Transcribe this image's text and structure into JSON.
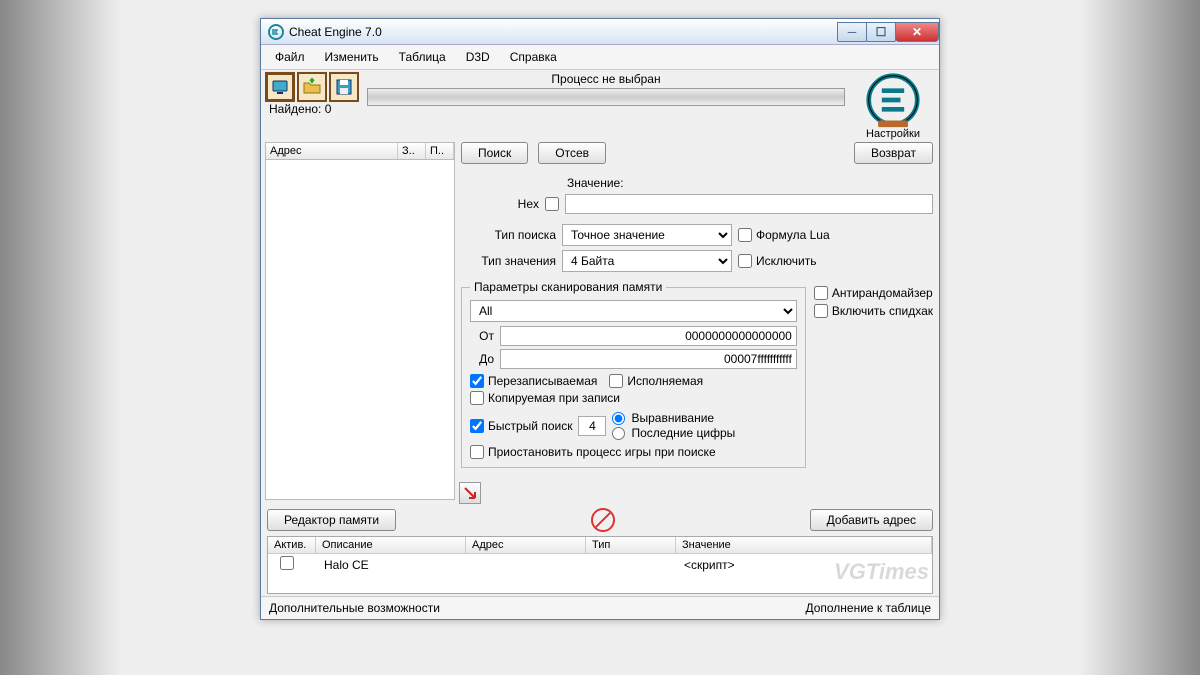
{
  "window": {
    "title": "Cheat Engine 7.0"
  },
  "menu": {
    "file": "Файл",
    "edit": "Изменить",
    "table": "Таблица",
    "d3d": "D3D",
    "help": "Справка"
  },
  "toolbar": {
    "process_status": "Процесс не выбран",
    "found_label": "Найдено:",
    "found_count": "0"
  },
  "logo": {
    "settings": "Настройки"
  },
  "results": {
    "col_address": "Адрес",
    "col_s": "З..",
    "col_p": "П.."
  },
  "buttons": {
    "search": "Поиск",
    "filter": "Отсев",
    "undo": "Возврат",
    "mem_editor": "Редактор памяти",
    "add_addr": "Добавить адрес"
  },
  "labels": {
    "value": "Значение:",
    "hex": "Hex",
    "search_type": "Тип поиска",
    "value_type": "Тип значения",
    "lua": "Формула Lua",
    "exclude": "Исключить",
    "scan_params": "Параметры сканирования памяти",
    "from": "От",
    "to": "До",
    "writable": "Перезаписываемая",
    "executable": "Исполняемая",
    "cow": "Копируемая при записи",
    "fast": "Быстрый поиск",
    "alignment": "Выравнивание",
    "last_digits": "Последние цифры",
    "pause": "Приостановить процесс игры при поиске",
    "antirand": "Антирандомайзер",
    "speedhack": "Включить спидхак"
  },
  "values": {
    "search_type_sel": "Точное значение",
    "value_type_sel": "4 Байта",
    "mem_region": "All",
    "from_val": "0000000000000000",
    "to_val": "00007fffffffffff",
    "fast_val": "4"
  },
  "bottom": {
    "col_active": "Актив.",
    "col_desc": "Описание",
    "col_addr": "Адрес",
    "col_type": "Тип",
    "col_value": "Значение",
    "row0_desc": "Halo CE",
    "row0_value": "<скрипт>"
  },
  "footer": {
    "left": "Дополнительные возможности",
    "right": "Дополнение к таблице"
  }
}
